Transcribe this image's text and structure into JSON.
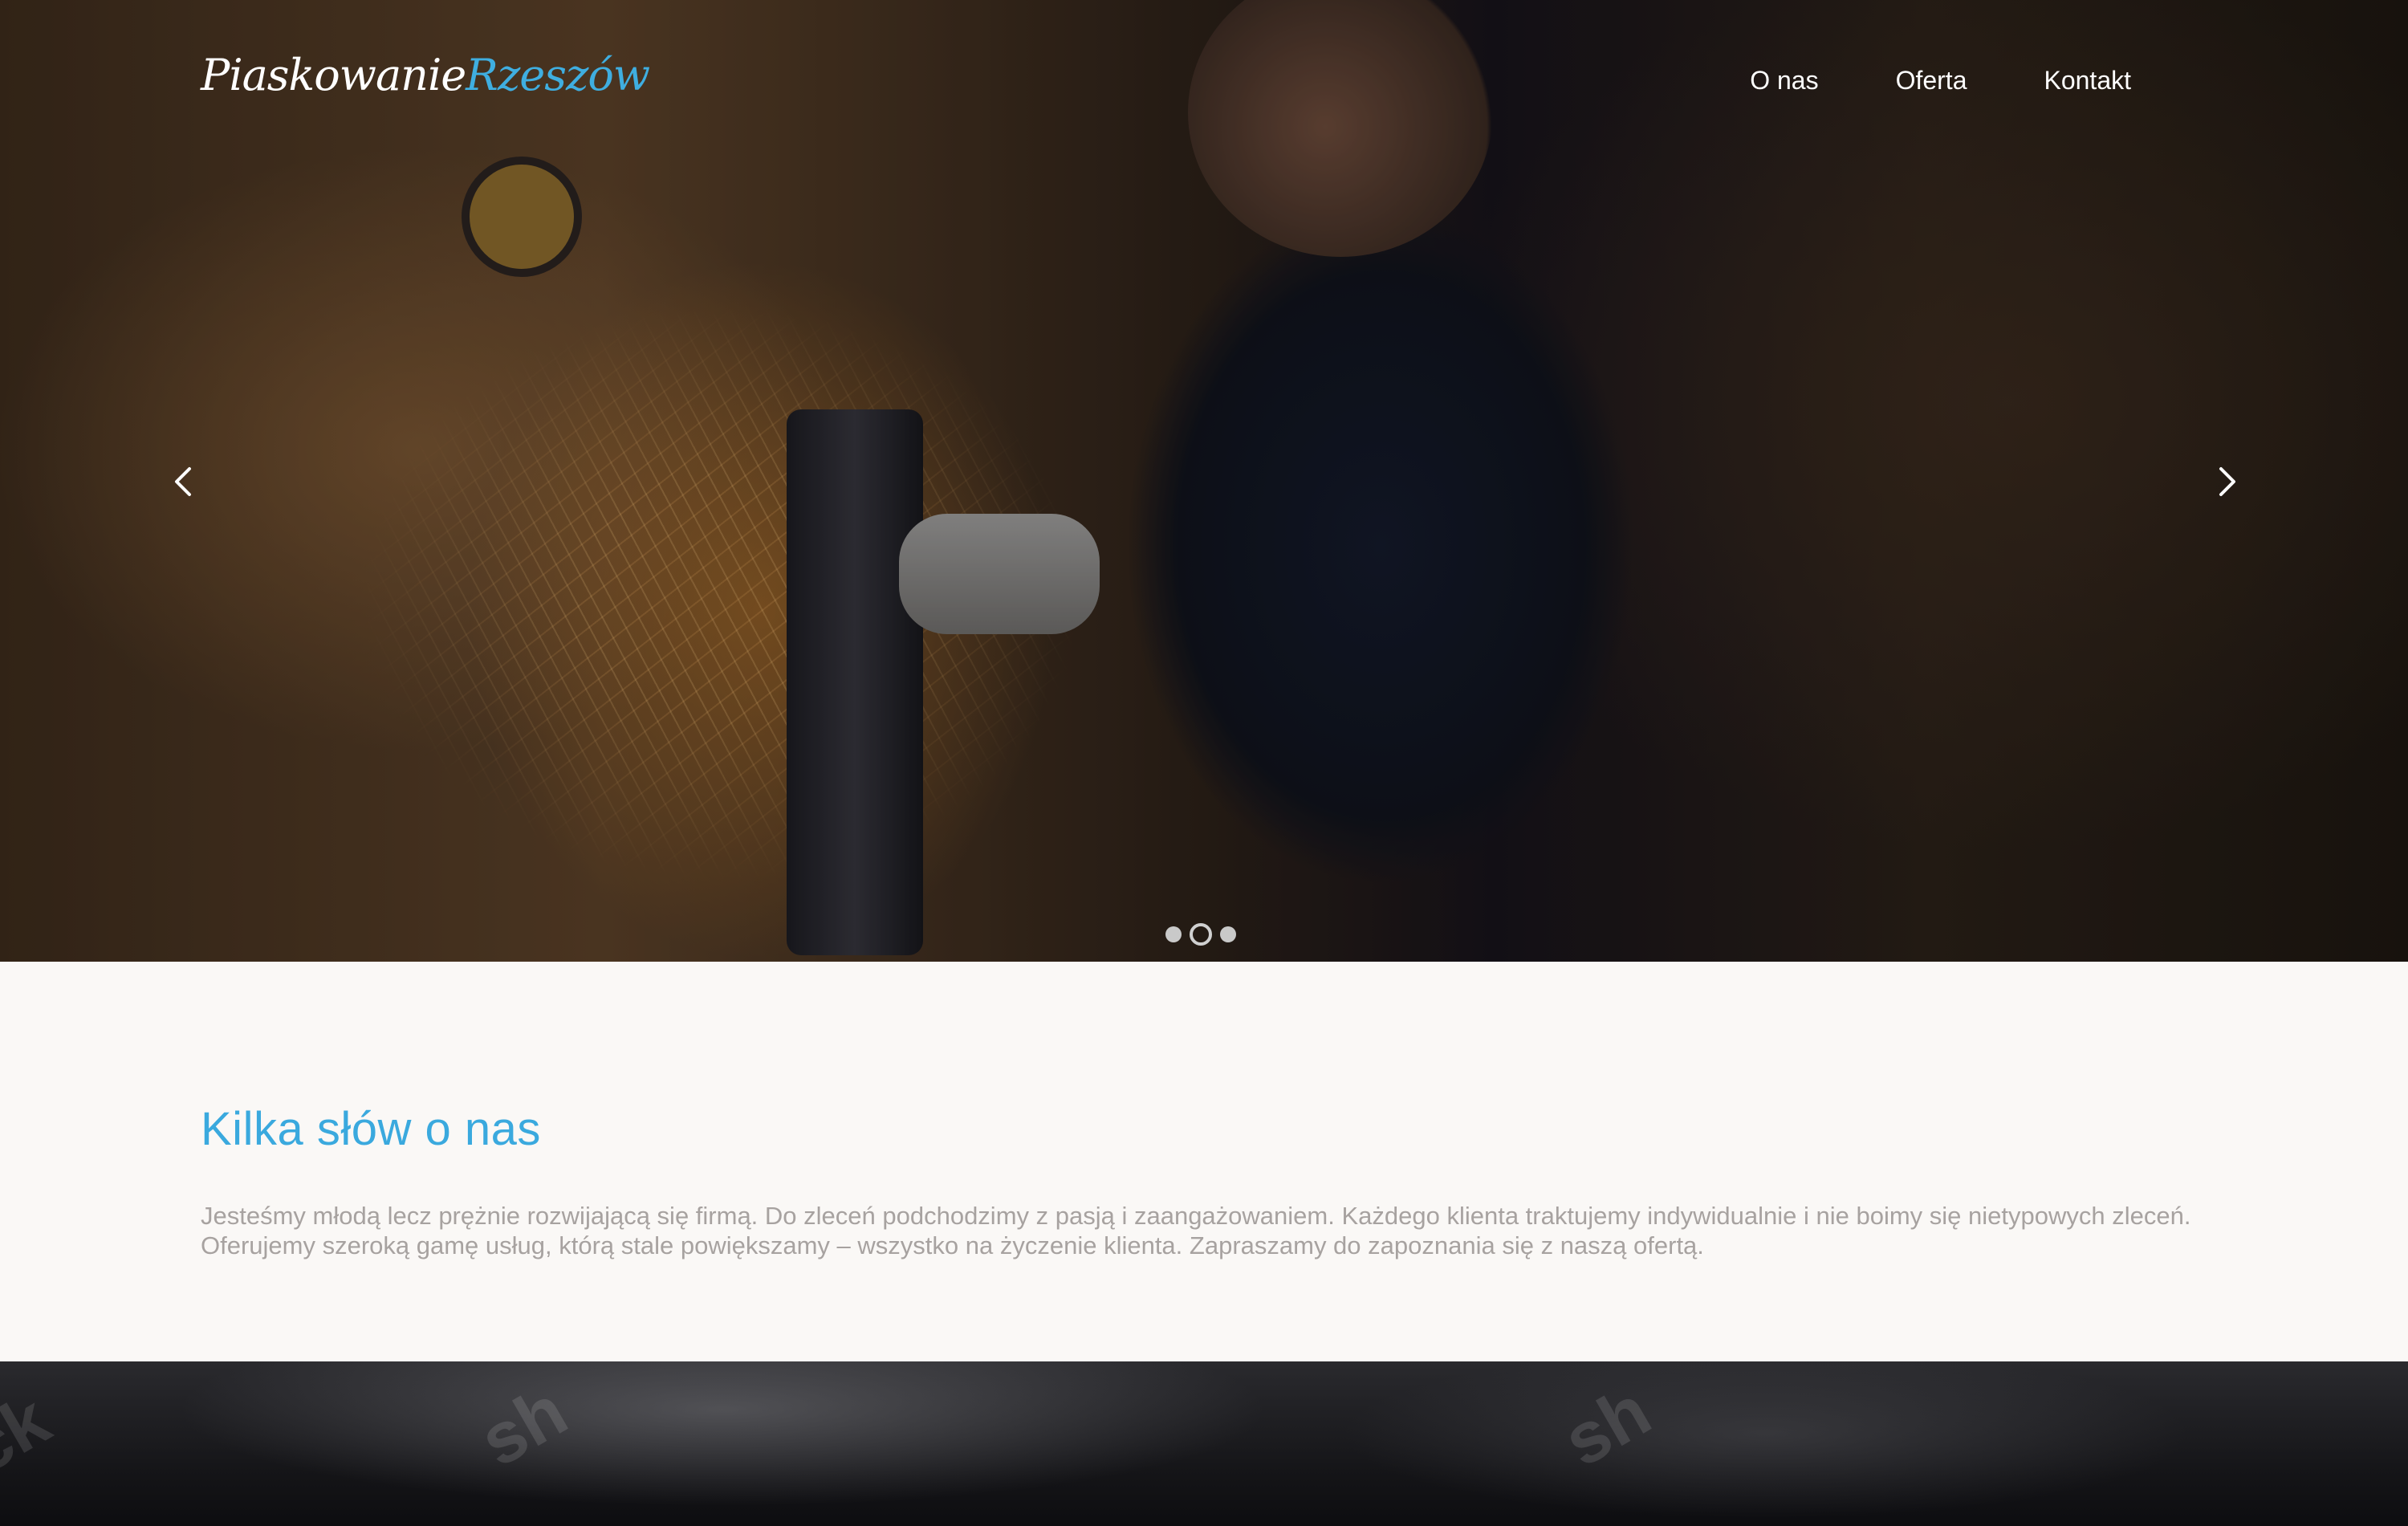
{
  "header": {
    "logo_part1": "Piaskowanie",
    "logo_part2": "Rzeszów",
    "nav": [
      "O nas",
      "Oferta",
      "Kontakt"
    ]
  },
  "slider": {
    "slides": 3,
    "active_slide": 2,
    "prev_icon": "chevron-left-icon",
    "next_icon": "chevron-right-icon"
  },
  "about": {
    "title": "Kilka słów o nas",
    "text": "Jesteśmy młodą lecz prężnie rozwijającą się firmą. Do zleceń podchodzimy z pasją i zaangażowaniem. Każdego klienta traktujemy indywidualnie i nie boimy się nietypowych zleceń. Oferujemy szeroką gamę usług, którą stale powiększamy – wszystko na życzenie klienta. Zapraszamy do zapoznania się z naszą ofertą."
  },
  "colors": {
    "accent": "#3aa9de",
    "body_text": "#a7a2a0",
    "section_bg": "#faf8f6"
  }
}
